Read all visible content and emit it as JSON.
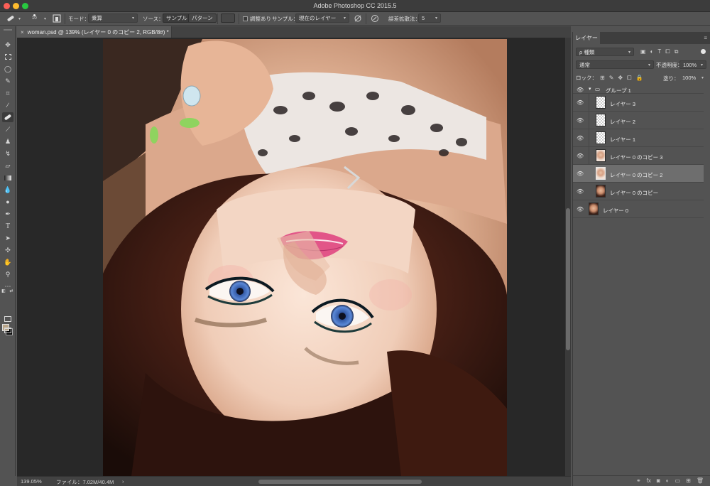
{
  "window": {
    "title": "Adobe Photoshop CC 2015.5"
  },
  "options_bar": {
    "brush_size": "10",
    "mode_label": "モード：",
    "mode_value": "乗算",
    "source_label": "ソース：",
    "source_sample": "サンプル",
    "source_pattern": "パターン",
    "aligned_label": "調整あり",
    "sample_label": "サンプル：",
    "sample_value": "現在のレイヤー",
    "diffusion_label": "誤差拡散法：",
    "diffusion_value": "5"
  },
  "document_tab": {
    "close": "×",
    "title": "woman.psd @ 139% (レイヤー 0 のコピー 2, RGB/8#) *"
  },
  "status_bar": {
    "zoom": "139.05%",
    "file_info": "ファイル：7.02M/40.4M",
    "arrow": "›"
  },
  "layers_panel": {
    "tab": "レイヤー",
    "filter_value": "ρ 種類",
    "blend_mode": "通常",
    "opacity_label": "不透明度：",
    "opacity_value": "100%",
    "lock_label": "ロック：",
    "fill_label": "塗り：",
    "fill_value": "100%",
    "layers": [
      {
        "name": "グループ 1",
        "kind": "group",
        "selected": false
      },
      {
        "name": "レイヤー 3",
        "kind": "empty",
        "selected": false
      },
      {
        "name": "レイヤー 2",
        "kind": "empty",
        "selected": false
      },
      {
        "name": "レイヤー 1",
        "kind": "empty",
        "selected": false
      },
      {
        "name": "レイヤー 0 のコピー 3",
        "kind": "pale",
        "selected": false
      },
      {
        "name": "レイヤー 0 のコピー 2",
        "kind": "pale",
        "selected": true
      },
      {
        "name": "レイヤー 0 のコピー",
        "kind": "photo",
        "selected": false
      },
      {
        "name": "レイヤー 0",
        "kind": "photo",
        "selected": false
      }
    ]
  },
  "colors": {
    "foreground": "#b8a488",
    "background": "#000000",
    "accent_selected_layer": "#6e6e6e"
  },
  "icons": {
    "tools": [
      "move-tool-icon",
      "marquee-tool-icon",
      "lasso-tool-icon",
      "quick-select-tool-icon",
      "crop-tool-icon",
      "eyedropper-tool-icon",
      "healing-brush-tool-icon",
      "brush-tool-icon",
      "clone-stamp-tool-icon",
      "history-brush-tool-icon",
      "eraser-tool-icon",
      "gradient-tool-icon",
      "blur-tool-icon",
      "dodge-tool-icon",
      "pen-tool-icon",
      "type-tool-icon",
      "path-select-tool-icon",
      "shape-tool-icon",
      "hand-tool-icon",
      "zoom-tool-icon",
      "more-tools-icon"
    ]
  }
}
